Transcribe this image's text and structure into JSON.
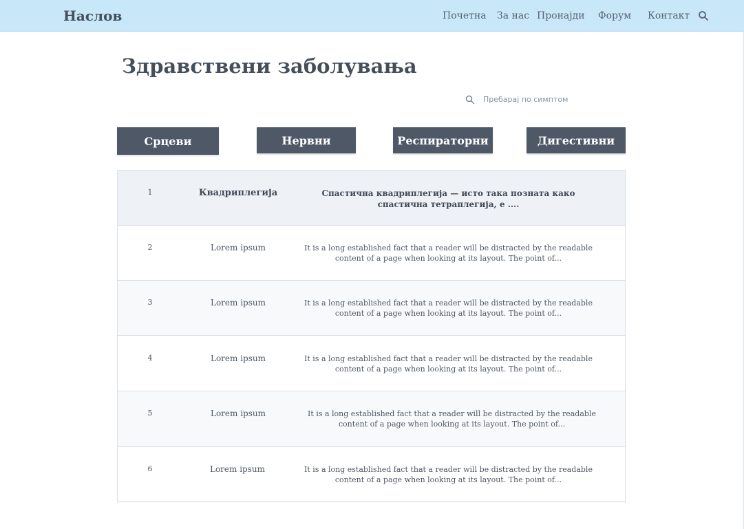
{
  "header": {
    "brand": "Наслов",
    "nav": [
      "Почетна",
      "За нас",
      "Пронајди",
      "Форум",
      "Контакт"
    ],
    "search_icon": "search-icon"
  },
  "main": {
    "title": "Здравствени заболувања",
    "search": {
      "placeholder": "Пребарај по симптом",
      "icon": "search-icon"
    },
    "categories": [
      "Срцеви",
      "Нервни",
      "Респираторни",
      "Дигестивни"
    ],
    "rows": [
      {
        "num": "1",
        "name": "Квадриплегија",
        "desc": "Спастична квадриплегија — исто така позната како спастична тетраплегија, е ...."
      },
      {
        "num": "2",
        "name": "Lorem ipsum",
        "desc": "It is a long established fact that a reader will be distracted by the readable content of a page when looking at its layout. The point of..."
      },
      {
        "num": "3",
        "name": "Lorem ipsum",
        "desc": "It is a long established fact that a reader will be distracted by the readable content of a page when looking at its layout. The point of..."
      },
      {
        "num": "4",
        "name": "Lorem ipsum",
        "desc": "It is a long established fact that a reader will be distracted by the readable content of a page when looking at its layout. The point of..."
      },
      {
        "num": "5",
        "name": "Lorem ipsum",
        "desc": "It is a long established fact that a reader will be distracted by the readable content of a page when looking at its layout. The point of..."
      },
      {
        "num": "6",
        "name": "Lorem ipsum",
        "desc": "It is a long established fact that a reader will be distracted by the readable content of a page when looking at its layout. The point of..."
      }
    ]
  },
  "colors": {
    "navbar_bg": "#c8e7f9",
    "button_bg": "#4e5866",
    "first_row_bg": "#eef2f7",
    "alt_row_bg": "#f7f9fb"
  }
}
